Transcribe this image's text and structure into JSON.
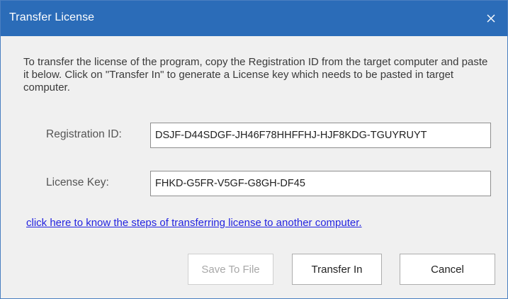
{
  "window": {
    "title": "Transfer License",
    "close_icon": "close-icon"
  },
  "description": "To transfer the license of the program, copy the Registration ID from the target computer and paste it below. Click on \"Transfer In\" to generate a License key which needs to be pasted in target computer.",
  "registration": {
    "label": "Registration ID:",
    "value": "DSJF-D44SDGF-JH46F78HHFFHJ-HJF8KDG-TGUYRUYT"
  },
  "license": {
    "label": "License Key:",
    "value": "FHKD-G5FR-V5GF-G8GH-DF45"
  },
  "help_link": "click here to know the steps of transferring license to another computer.",
  "buttons": {
    "save_to_file": "Save To File",
    "transfer_in": "Transfer In",
    "cancel": "Cancel"
  },
  "colors": {
    "titlebar": "#2b6cb8",
    "link": "#2424e0",
    "dialog_bg": "#f0f0f0"
  }
}
